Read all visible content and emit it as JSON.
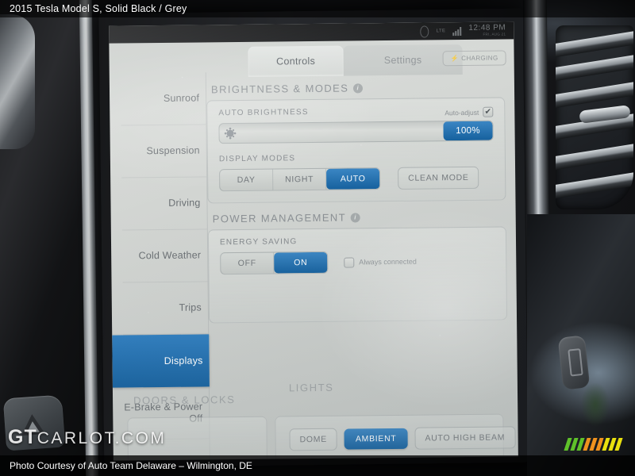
{
  "overlay": {
    "top_caption": "2015 Tesla Model S,  Solid Black / Grey",
    "bottom_caption": "Photo Courtesy of Auto Team Delaware – Wilmington, DE",
    "watermark_primary": "GT",
    "watermark_secondary": "CARLOT.COM"
  },
  "statusbar": {
    "network": "LTE",
    "time": "12:48 PM",
    "date": "FRI, AUG 21"
  },
  "tabs": [
    {
      "label": "Controls",
      "active": true
    },
    {
      "label": "Settings",
      "active": false
    }
  ],
  "charging_button": {
    "label": "CHARGING",
    "icon": "bolt-icon"
  },
  "sidebar": {
    "items": [
      {
        "label": "Sunroof",
        "active": false
      },
      {
        "label": "Suspension",
        "active": false
      },
      {
        "label": "Driving",
        "active": false
      },
      {
        "label": "Cold Weather",
        "active": false
      },
      {
        "label": "Trips",
        "active": false
      },
      {
        "label": "Displays",
        "active": true
      },
      {
        "label": "E-Brake & Power Off",
        "active": false
      }
    ]
  },
  "brightness_section": {
    "title": "BRIGHTNESS & MODES",
    "info_icon": "info-icon",
    "auto_brightness": {
      "label": "AUTO BRIGHTNESS",
      "auto_adjust_label": "Auto-adjust",
      "auto_adjust_checked": true,
      "check_glyph": "✔",
      "slider_value": "100%",
      "slider_percent": 100,
      "sun_icon": "sun-icon"
    },
    "display_modes": {
      "label": "DISPLAY MODES",
      "options": [
        {
          "label": "DAY",
          "selected": false
        },
        {
          "label": "NIGHT",
          "selected": false
        },
        {
          "label": "AUTO",
          "selected": true
        }
      ],
      "clean_mode_label": "CLEAN MODE"
    }
  },
  "power_section": {
    "title": "POWER MANAGEMENT",
    "info_icon": "info-icon",
    "energy_saving": {
      "label": "ENERGY SAVING",
      "options": [
        {
          "label": "OFF",
          "selected": false
        },
        {
          "label": "ON",
          "selected": true
        }
      ],
      "always_connected_label": "Always connected",
      "always_connected_checked": false
    }
  },
  "dock": {
    "doors_label": "DOORS & LOCKS",
    "lights_label": "LIGHTS",
    "lights_buttons": [
      {
        "label": "DOME",
        "selected": false
      },
      {
        "label": "AMBIENT",
        "selected": true
      },
      {
        "label": "AUTO HIGH BEAM",
        "selected": false
      }
    ]
  },
  "colors": {
    "accent_blue": "#2176bb",
    "accent_blue_dark": "#14609e",
    "screen_base": "#cfd2cf",
    "text_grey": "#6b7074"
  }
}
